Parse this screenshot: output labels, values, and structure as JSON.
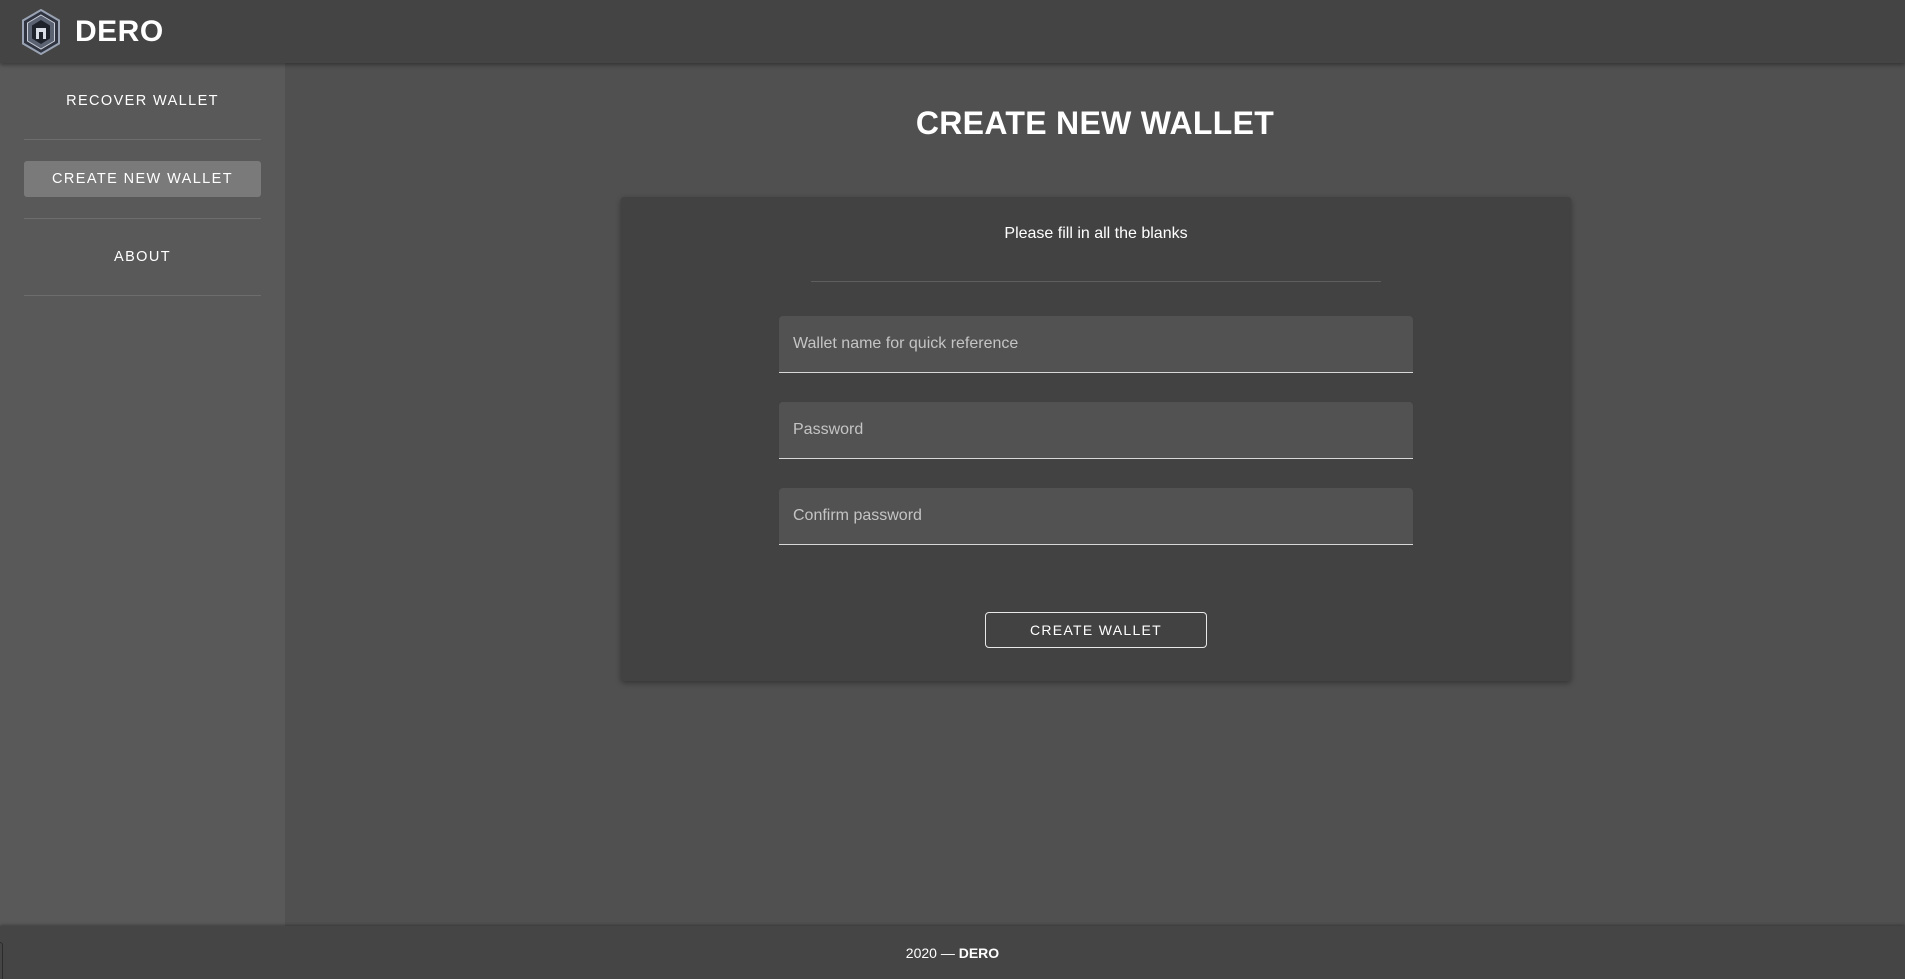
{
  "app": {
    "brand": "DERO",
    "logo_icon": "dero-logo-icon"
  },
  "sidebar": {
    "items": [
      {
        "label": "RECOVER WALLET",
        "active": false
      },
      {
        "label": "CREATE NEW WALLET",
        "active": true
      },
      {
        "label": "ABOUT",
        "active": false
      }
    ]
  },
  "main": {
    "title": "CREATE NEW WALLET",
    "card": {
      "subtitle": "Please fill in all the blanks",
      "fields": {
        "wallet_name": {
          "placeholder": "Wallet name for quick reference",
          "value": ""
        },
        "password": {
          "placeholder": "Password",
          "value": ""
        },
        "confirm_password": {
          "placeholder": "Confirm password",
          "value": ""
        }
      },
      "submit_label": "CREATE WALLET"
    }
  },
  "footer": {
    "year_text": "2020 — ",
    "brand": "DERO"
  },
  "colors": {
    "background": "#505050",
    "appbar": "#444444",
    "sidebar": "#595959",
    "card": "#424242",
    "active_item": "#7a7a7a"
  }
}
